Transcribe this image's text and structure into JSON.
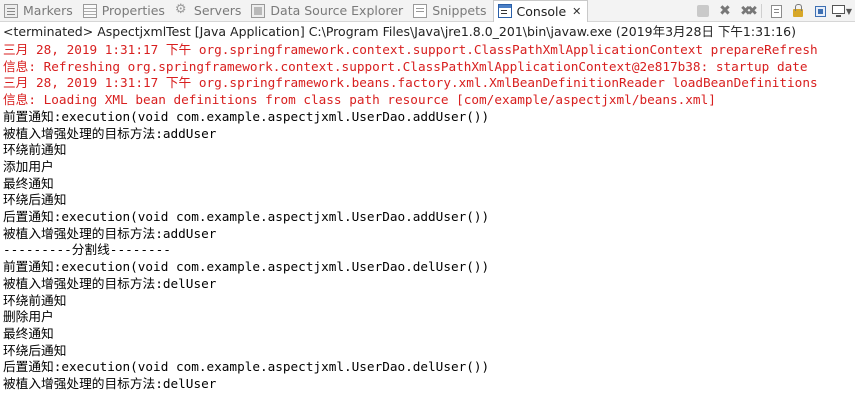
{
  "tabs": [
    {
      "label": "Markers",
      "icon": "markers-icon"
    },
    {
      "label": "Properties",
      "icon": "properties-icon"
    },
    {
      "label": "Servers",
      "icon": "servers-icon"
    },
    {
      "label": "Data Source Explorer",
      "icon": "data-source-explorer-icon"
    },
    {
      "label": "Snippets",
      "icon": "snippets-icon"
    },
    {
      "label": "Console",
      "icon": "console-icon",
      "active": true
    }
  ],
  "console_close_glyph": "✕",
  "status": "<terminated> AspectjxmlTest [Java Application] C:\\Program Files\\Java\\jre1.8.0_201\\bin\\javaw.exe (2019年3月28日 下午1:31:16)",
  "output": [
    {
      "text": "三月 28, 2019 1:31:17 下午 org.springframework.context.support.ClassPathXmlApplicationContext prepareRefresh",
      "err": true
    },
    {
      "text": "信息: Refreshing org.springframework.context.support.ClassPathXmlApplicationContext@2e817b38: startup date",
      "err": true
    },
    {
      "text": "三月 28, 2019 1:31:17 下午 org.springframework.beans.factory.xml.XmlBeanDefinitionReader loadBeanDefinitions",
      "err": true
    },
    {
      "text": "信息: Loading XML bean definitions from class path resource [com/example/aspectjxml/beans.xml]",
      "err": true
    },
    {
      "text": "前置通知:execution(void com.example.aspectjxml.UserDao.addUser())",
      "err": false
    },
    {
      "text": "被植入增强处理的目标方法:addUser",
      "err": false
    },
    {
      "text": "环绕前通知",
      "err": false
    },
    {
      "text": "添加用户",
      "err": false
    },
    {
      "text": "最终通知",
      "err": false
    },
    {
      "text": "环绕后通知",
      "err": false
    },
    {
      "text": "后置通知:execution(void com.example.aspectjxml.UserDao.addUser())",
      "err": false
    },
    {
      "text": "被植入增强处理的目标方法:addUser",
      "err": false
    },
    {
      "text": "---------分割线--------",
      "err": false
    },
    {
      "text": "前置通知:execution(void com.example.aspectjxml.UserDao.delUser())",
      "err": false
    },
    {
      "text": "被植入增强处理的目标方法:delUser",
      "err": false
    },
    {
      "text": "环绕前通知",
      "err": false
    },
    {
      "text": "删除用户",
      "err": false
    },
    {
      "text": "最终通知",
      "err": false
    },
    {
      "text": "环绕后通知",
      "err": false
    },
    {
      "text": "后置通知:execution(void com.example.aspectjxml.UserDao.delUser())",
      "err": false
    },
    {
      "text": "被植入增强处理的目标方法:delUser",
      "err": false
    }
  ],
  "colors": {
    "error_text": "#d81f1f",
    "normal_text": "#000000"
  }
}
